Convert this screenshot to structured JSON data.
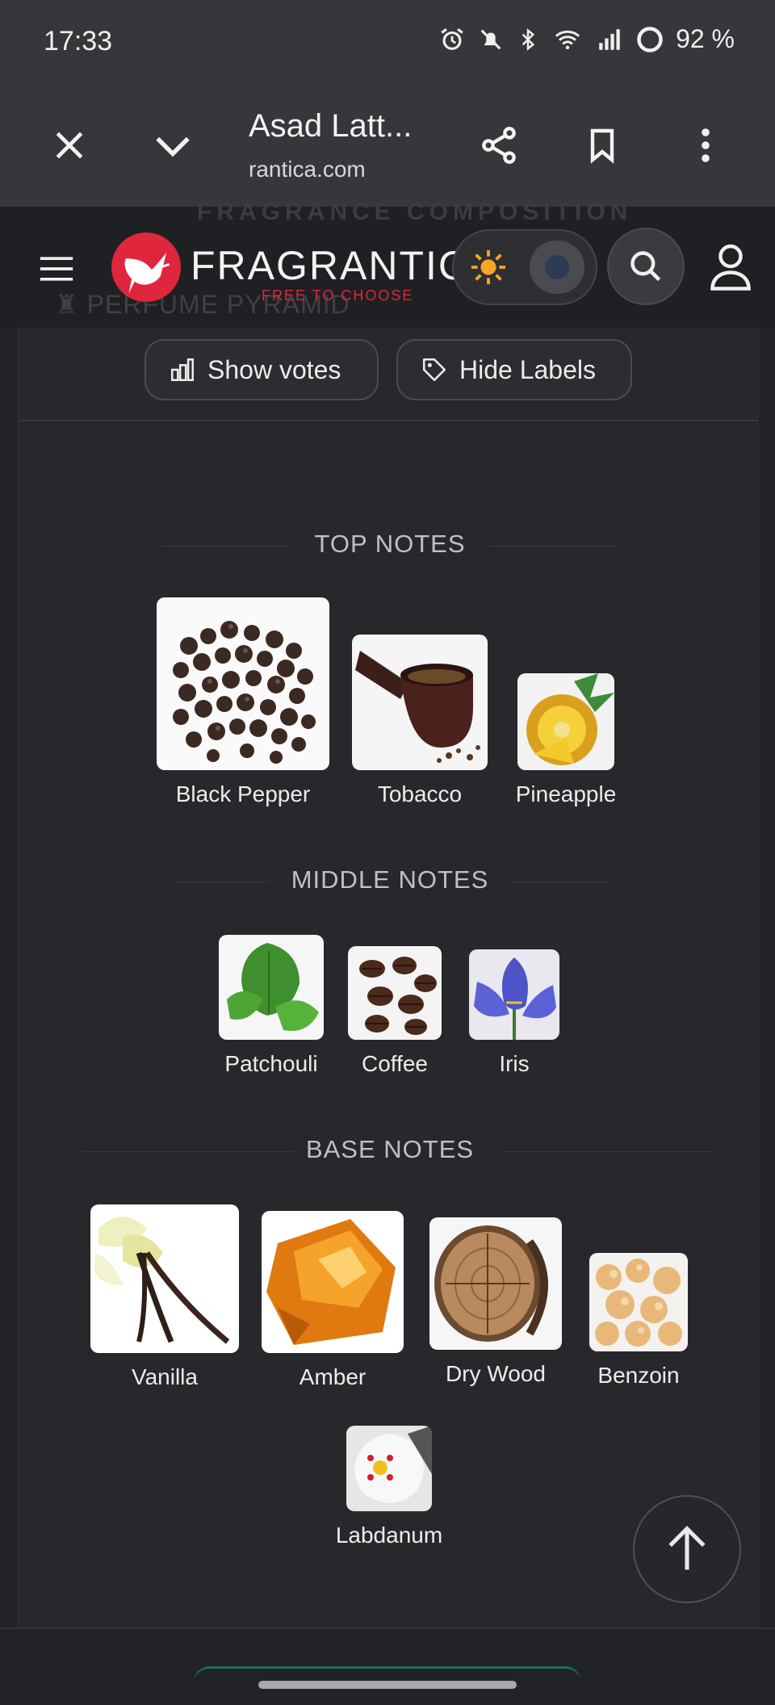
{
  "status_bar": {
    "time": "17:33",
    "battery": "92 %"
  },
  "browser": {
    "title": "Asad Latt...",
    "url": "rantica.com"
  },
  "site": {
    "logo_text": "FRAGRANTICA",
    "tagline": "FREE TO CHOOSE",
    "ghost_heading": "FRAGRANCE COMPOSITION",
    "ghost_pyramid": "PERFUME PYRAMID"
  },
  "buttons": {
    "show_votes": "Show votes",
    "hide_labels": "Hide Labels"
  },
  "top_notes": {
    "title": "TOP NOTES",
    "items": [
      {
        "label": "Black Pepper"
      },
      {
        "label": "Tobacco"
      },
      {
        "label": "Pineapple"
      }
    ]
  },
  "middle_notes": {
    "title": "MIDDLE NOTES",
    "items": [
      {
        "label": "Patchouli"
      },
      {
        "label": "Coffee"
      },
      {
        "label": "Iris"
      }
    ]
  },
  "base_notes": {
    "title": "BASE NOTES",
    "items": [
      {
        "label": "Vanilla"
      },
      {
        "label": "Amber"
      },
      {
        "label": "Dry Wood"
      },
      {
        "label": "Benzoin"
      },
      {
        "label": "Labdanum"
      }
    ]
  },
  "colors": {
    "brand": "#e0263c",
    "background": "#222326",
    "panel": "#27282b"
  },
  "icons": [
    "close-icon",
    "chevron-down-icon",
    "share-icon",
    "bookmark-icon",
    "more-vert-icon",
    "hamburger-icon",
    "sun-icon",
    "moon-icon",
    "search-icon",
    "user-icon",
    "chart-icon",
    "tag-icon",
    "arrow-up-icon"
  ]
}
